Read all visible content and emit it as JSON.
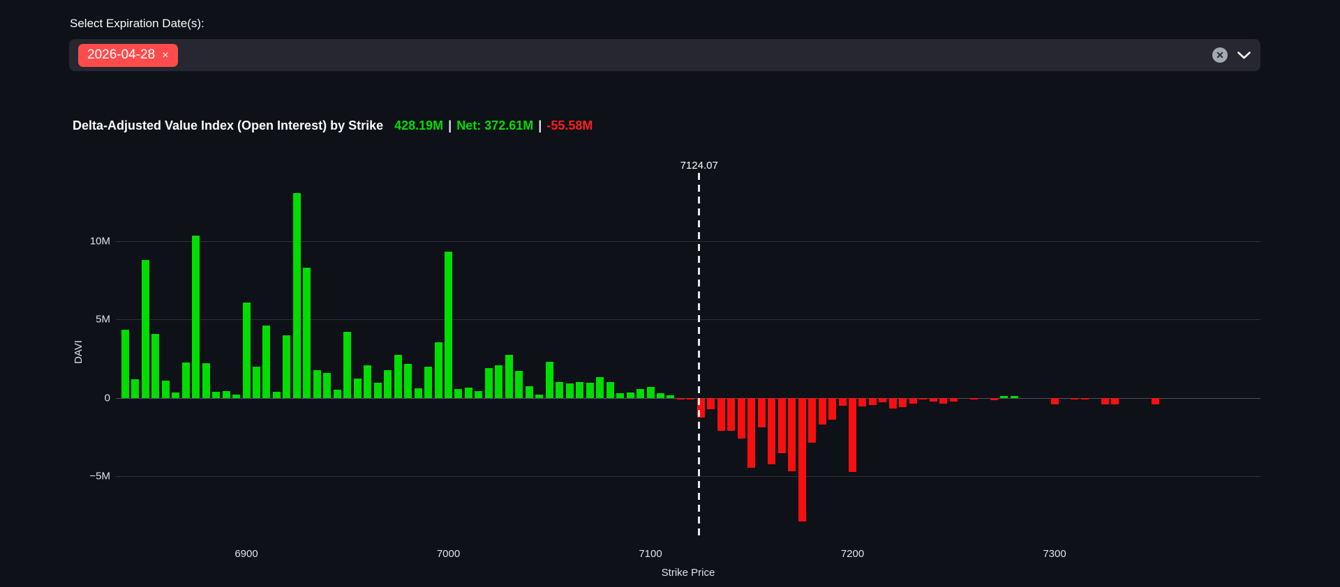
{
  "page": {
    "background_color": "#0e1117"
  },
  "expiration_select": {
    "label": "Select Expiration Date(s):",
    "tags": [
      {
        "label": "2026-04-28",
        "remove_glyph": "×"
      }
    ],
    "tag_color": "#ff4b4b",
    "clear_all_glyph": "✕"
  },
  "chart_header": {
    "title": "Delta-Adjusted Value Index (Open Interest) by Strike",
    "positive_total": "428.19M",
    "separator": "|",
    "net": "Net: 372.61M",
    "negative_total": "-55.58M",
    "positive_color": "#00dd00",
    "negative_color": "#ff1e1e"
  },
  "chart_data": {
    "type": "bar",
    "title": "Delta-Adjusted Value Index (Open Interest) by Strike",
    "xlabel": "Strike Price",
    "ylabel": "DAVI",
    "value_unit": "M (millions)",
    "grid": true,
    "legend": "none",
    "xlim": [
      6835.4,
      7401.9
    ],
    "ylim_m": [
      -9.1,
      15.35
    ],
    "y_ticks": [
      {
        "value": 10,
        "label": "10M"
      },
      {
        "value": 5,
        "label": "5M"
      },
      {
        "value": 0,
        "label": "0"
      },
      {
        "value": -5,
        "label": "−5M"
      }
    ],
    "x_ticks": [
      {
        "value": 6900,
        "label": "6900"
      },
      {
        "value": 7000,
        "label": "7000"
      },
      {
        "value": 7100,
        "label": "7100"
      },
      {
        "value": 7200,
        "label": "7200"
      },
      {
        "value": 7300,
        "label": "7300"
      }
    ],
    "vline": {
      "x": 7124.07,
      "label": "7124.07",
      "style": "dashed",
      "color": "#e8e8e8"
    },
    "positive_color": "#00dd00",
    "negative_color": "#f80f0f",
    "points": [
      [
        6840,
        4.35
      ],
      [
        6845,
        1.2
      ],
      [
        6850,
        8.8
      ],
      [
        6855,
        4.1
      ],
      [
        6860,
        1.1
      ],
      [
        6865,
        0.35
      ],
      [
        6870,
        2.25
      ],
      [
        6875,
        10.35
      ],
      [
        6880,
        2.2
      ],
      [
        6885,
        0.4
      ],
      [
        6890,
        0.45
      ],
      [
        6895,
        0.2
      ],
      [
        6900,
        6.1
      ],
      [
        6905,
        2.0
      ],
      [
        6910,
        4.6
      ],
      [
        6915,
        0.4
      ],
      [
        6920,
        4.0
      ],
      [
        6925,
        13.1
      ],
      [
        6930,
        8.3
      ],
      [
        6935,
        1.75
      ],
      [
        6940,
        1.6
      ],
      [
        6945,
        0.5
      ],
      [
        6950,
        4.2
      ],
      [
        6955,
        1.25
      ],
      [
        6960,
        2.1
      ],
      [
        6965,
        0.95
      ],
      [
        6970,
        1.75
      ],
      [
        6975,
        2.75
      ],
      [
        6980,
        2.15
      ],
      [
        6985,
        0.6
      ],
      [
        6990,
        2.0
      ],
      [
        6995,
        3.55
      ],
      [
        7000,
        9.35
      ],
      [
        7005,
        0.55
      ],
      [
        7010,
        0.65
      ],
      [
        7015,
        0.45
      ],
      [
        7020,
        1.9
      ],
      [
        7025,
        2.1
      ],
      [
        7030,
        2.75
      ],
      [
        7035,
        1.7
      ],
      [
        7040,
        0.75
      ],
      [
        7045,
        0.2
      ],
      [
        7050,
        2.3
      ],
      [
        7055,
        1.0
      ],
      [
        7060,
        0.9
      ],
      [
        7065,
        1.0
      ],
      [
        7070,
        0.95
      ],
      [
        7075,
        1.3
      ],
      [
        7080,
        1.0
      ],
      [
        7085,
        0.3
      ],
      [
        7090,
        0.35
      ],
      [
        7095,
        0.55
      ],
      [
        7100,
        0.7
      ],
      [
        7105,
        0.3
      ],
      [
        7110,
        0.15
      ],
      [
        7115,
        -0.07
      ],
      [
        7120,
        -0.07
      ],
      [
        7125,
        -1.25
      ],
      [
        7130,
        -0.75
      ],
      [
        7135,
        -2.1
      ],
      [
        7140,
        -2.1
      ],
      [
        7145,
        -2.6
      ],
      [
        7150,
        -4.45
      ],
      [
        7155,
        -1.9
      ],
      [
        7160,
        -4.25
      ],
      [
        7165,
        -3.55
      ],
      [
        7170,
        -4.7
      ],
      [
        7175,
        -7.9
      ],
      [
        7180,
        -2.85
      ],
      [
        7185,
        -1.7
      ],
      [
        7190,
        -1.4
      ],
      [
        7195,
        -0.5
      ],
      [
        7200,
        -4.75
      ],
      [
        7205,
        -0.55
      ],
      [
        7210,
        -0.45
      ],
      [
        7215,
        -0.3
      ],
      [
        7220,
        -0.7
      ],
      [
        7225,
        -0.6
      ],
      [
        7230,
        -0.35
      ],
      [
        7235,
        -0.1
      ],
      [
        7240,
        -0.25
      ],
      [
        7245,
        -0.35
      ],
      [
        7250,
        -0.25
      ],
      [
        7260,
        -0.1
      ],
      [
        7270,
        -0.15
      ],
      [
        7275,
        0.1
      ],
      [
        7280,
        0.1
      ],
      [
        7300,
        -0.4
      ],
      [
        7310,
        -0.08
      ],
      [
        7315,
        -0.08
      ],
      [
        7325,
        -0.4
      ],
      [
        7330,
        -0.4
      ],
      [
        7350,
        -0.4
      ]
    ]
  }
}
